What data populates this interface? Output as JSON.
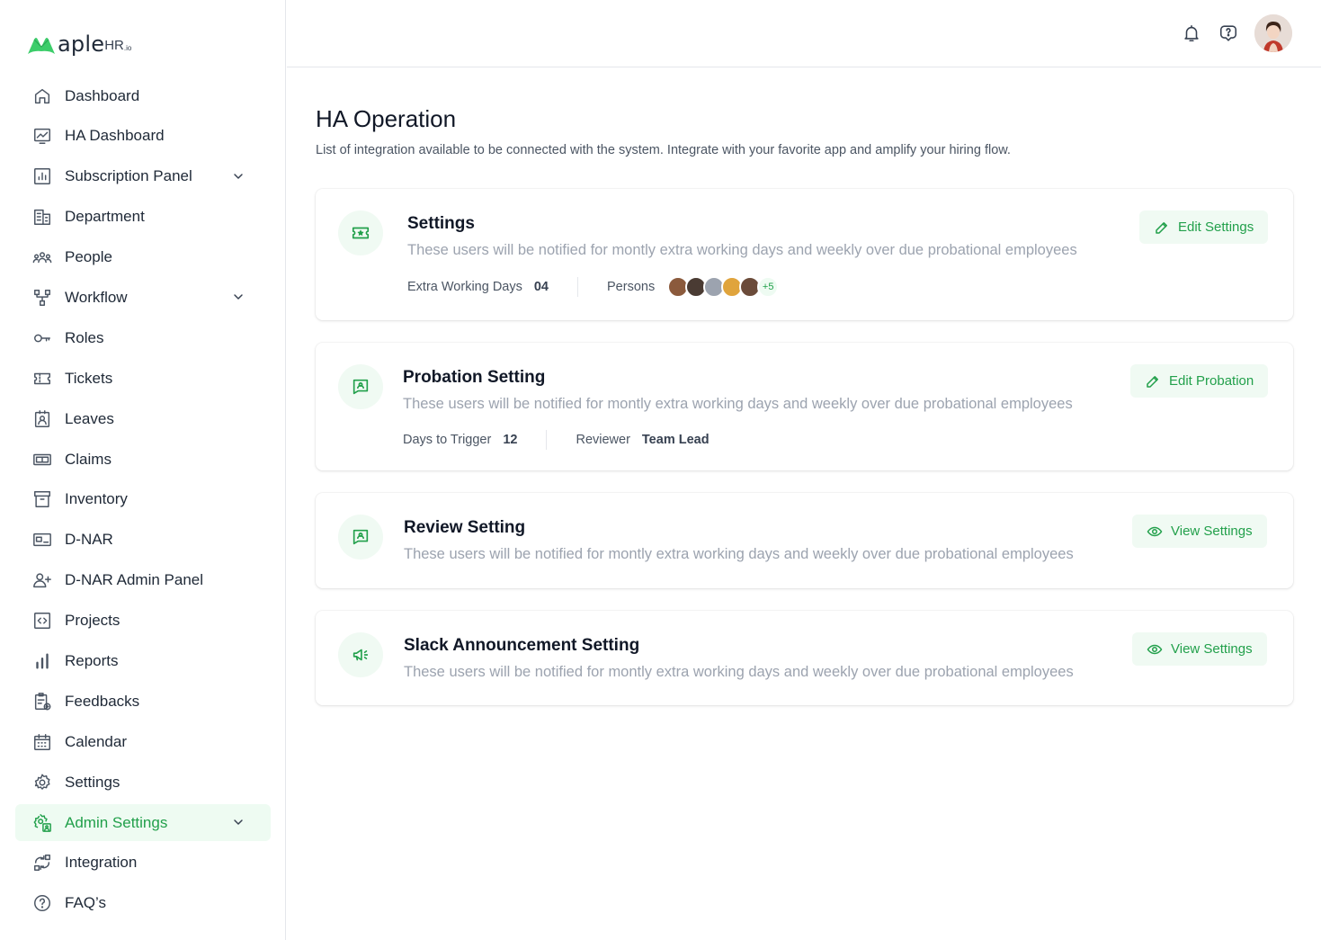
{
  "brand": {
    "logo_text": "aple",
    "logo_hr": "HR",
    "logo_io": ".io",
    "accent": "#22a04b"
  },
  "sidebar": {
    "items": [
      {
        "label": "Dashboard",
        "icon": "home-icon"
      },
      {
        "label": "HA Dashboard",
        "icon": "chart-board-icon"
      },
      {
        "label": "Subscription Panel",
        "icon": "bar-chart-square-icon",
        "expandable": true
      },
      {
        "label": "Department",
        "icon": "building-icon"
      },
      {
        "label": "People",
        "icon": "people-icon"
      },
      {
        "label": "Workflow",
        "icon": "workflow-icon",
        "expandable": true
      },
      {
        "label": "Roles",
        "icon": "key-icon"
      },
      {
        "label": "Tickets",
        "icon": "ticket-icon"
      },
      {
        "label": "Leaves",
        "icon": "id-badge-icon"
      },
      {
        "label": "Claims",
        "icon": "money-icon"
      },
      {
        "label": "Inventory",
        "icon": "archive-icon"
      },
      {
        "label": "D-NAR",
        "icon": "card-icon"
      },
      {
        "label": "D-NAR Admin Panel",
        "icon": "user-plus-icon"
      },
      {
        "label": "Projects",
        "icon": "code-square-icon"
      },
      {
        "label": "Reports",
        "icon": "bar-chart-icon"
      },
      {
        "label": "Feedbacks",
        "icon": "clipboard-icon"
      },
      {
        "label": "Calendar",
        "icon": "calendar-icon"
      },
      {
        "label": "Settings",
        "icon": "gear-icon"
      },
      {
        "label": "Admin Settings",
        "icon": "admin-gear-icon",
        "expandable": true,
        "active": true
      },
      {
        "label": "Integration",
        "icon": "integration-icon"
      },
      {
        "label": "FAQ’s",
        "icon": "question-icon"
      }
    ]
  },
  "topbar": {
    "icons": [
      "bell-icon",
      "help-icon"
    ],
    "avatar": "user-avatar"
  },
  "main": {
    "title": "HA Operation",
    "subtitle": "List of integration available to be connected with the system. Integrate with your favorite app and amplify your hiring flow.",
    "cards": [
      {
        "title": "Settings",
        "desc": "These users will be notified for montly extra working days and weekly over due probational employees",
        "button": "Edit Settings",
        "meta1_label": "Extra Working Days",
        "meta1_value": "04",
        "meta2_label": "Persons",
        "more": "+5"
      },
      {
        "title": "Probation Setting",
        "desc": "These users will be notified for montly extra working days and weekly over due probational employees",
        "button": "Edit Probation",
        "meta1_label": "Days to Trigger",
        "meta1_value": "12",
        "meta2_label": "Reviewer",
        "meta2_value": "Team Lead"
      },
      {
        "title": "Review Setting",
        "desc": "These users will be notified for montly extra working days and weekly over due probational employees",
        "button": "View Settings"
      },
      {
        "title": "Slack Announcement Setting",
        "desc": "These users will be notified for montly extra working days and weekly over due probational employees",
        "button": "View Settings"
      }
    ]
  }
}
